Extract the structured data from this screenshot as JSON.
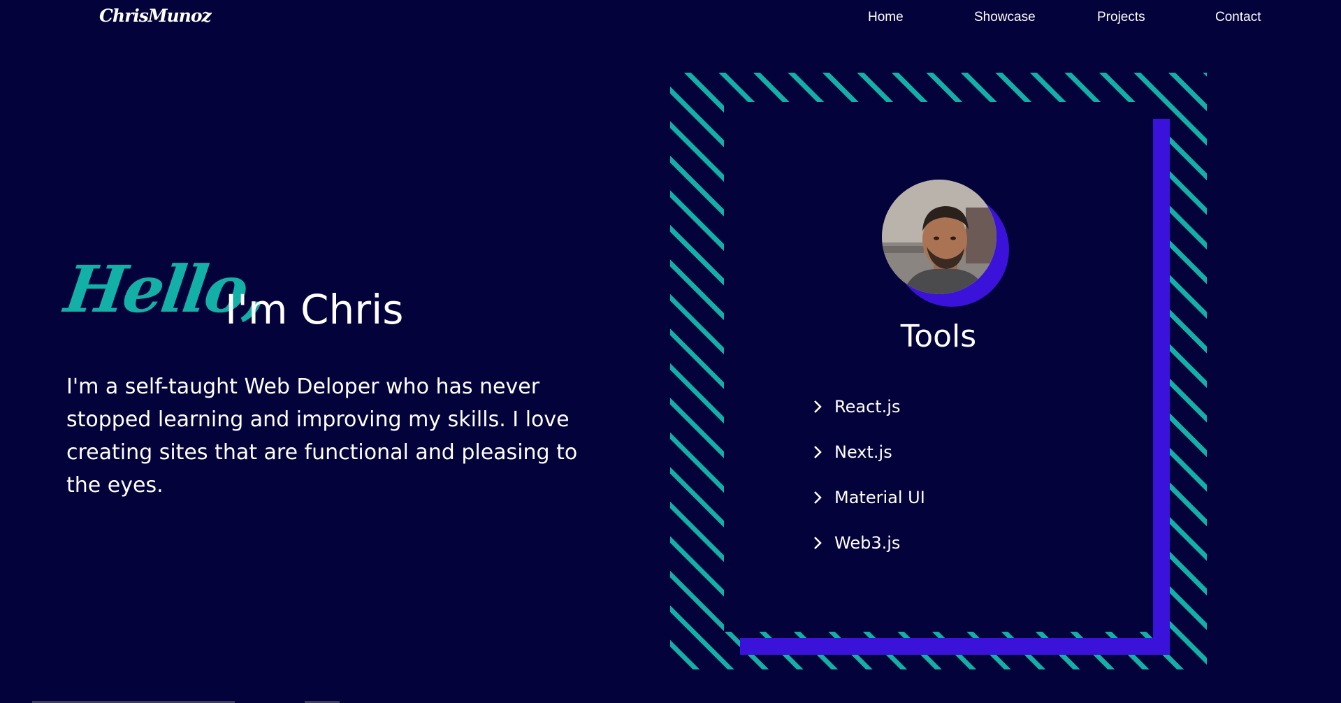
{
  "nav": {
    "logo": "ChrisMunoz",
    "links": [
      {
        "label": "Home"
      },
      {
        "label": "Showcase"
      },
      {
        "label": "Projects"
      },
      {
        "label": "Contact"
      }
    ]
  },
  "hero": {
    "greeting": "Hello,",
    "name_line": "I'm Chris",
    "bio": "I'm a self-taught Web Deloper who has never stopped learning and improving my skills. I love creating sites that are functional and pleasing to the eyes."
  },
  "card": {
    "avatar_icon": "profile-photo",
    "title": "Tools",
    "tools": [
      {
        "label": "React.js",
        "icon": "chevron-right-icon"
      },
      {
        "label": "Next.js",
        "icon": "chevron-right-icon"
      },
      {
        "label": "Material UI",
        "icon": "chevron-right-icon"
      },
      {
        "label": "Web3.js",
        "icon": "chevron-right-icon"
      }
    ]
  },
  "colors": {
    "background": "#03023a",
    "accent_teal": "#12b0a6",
    "accent_purple": "#3a12d9",
    "text": "#ffffff"
  }
}
